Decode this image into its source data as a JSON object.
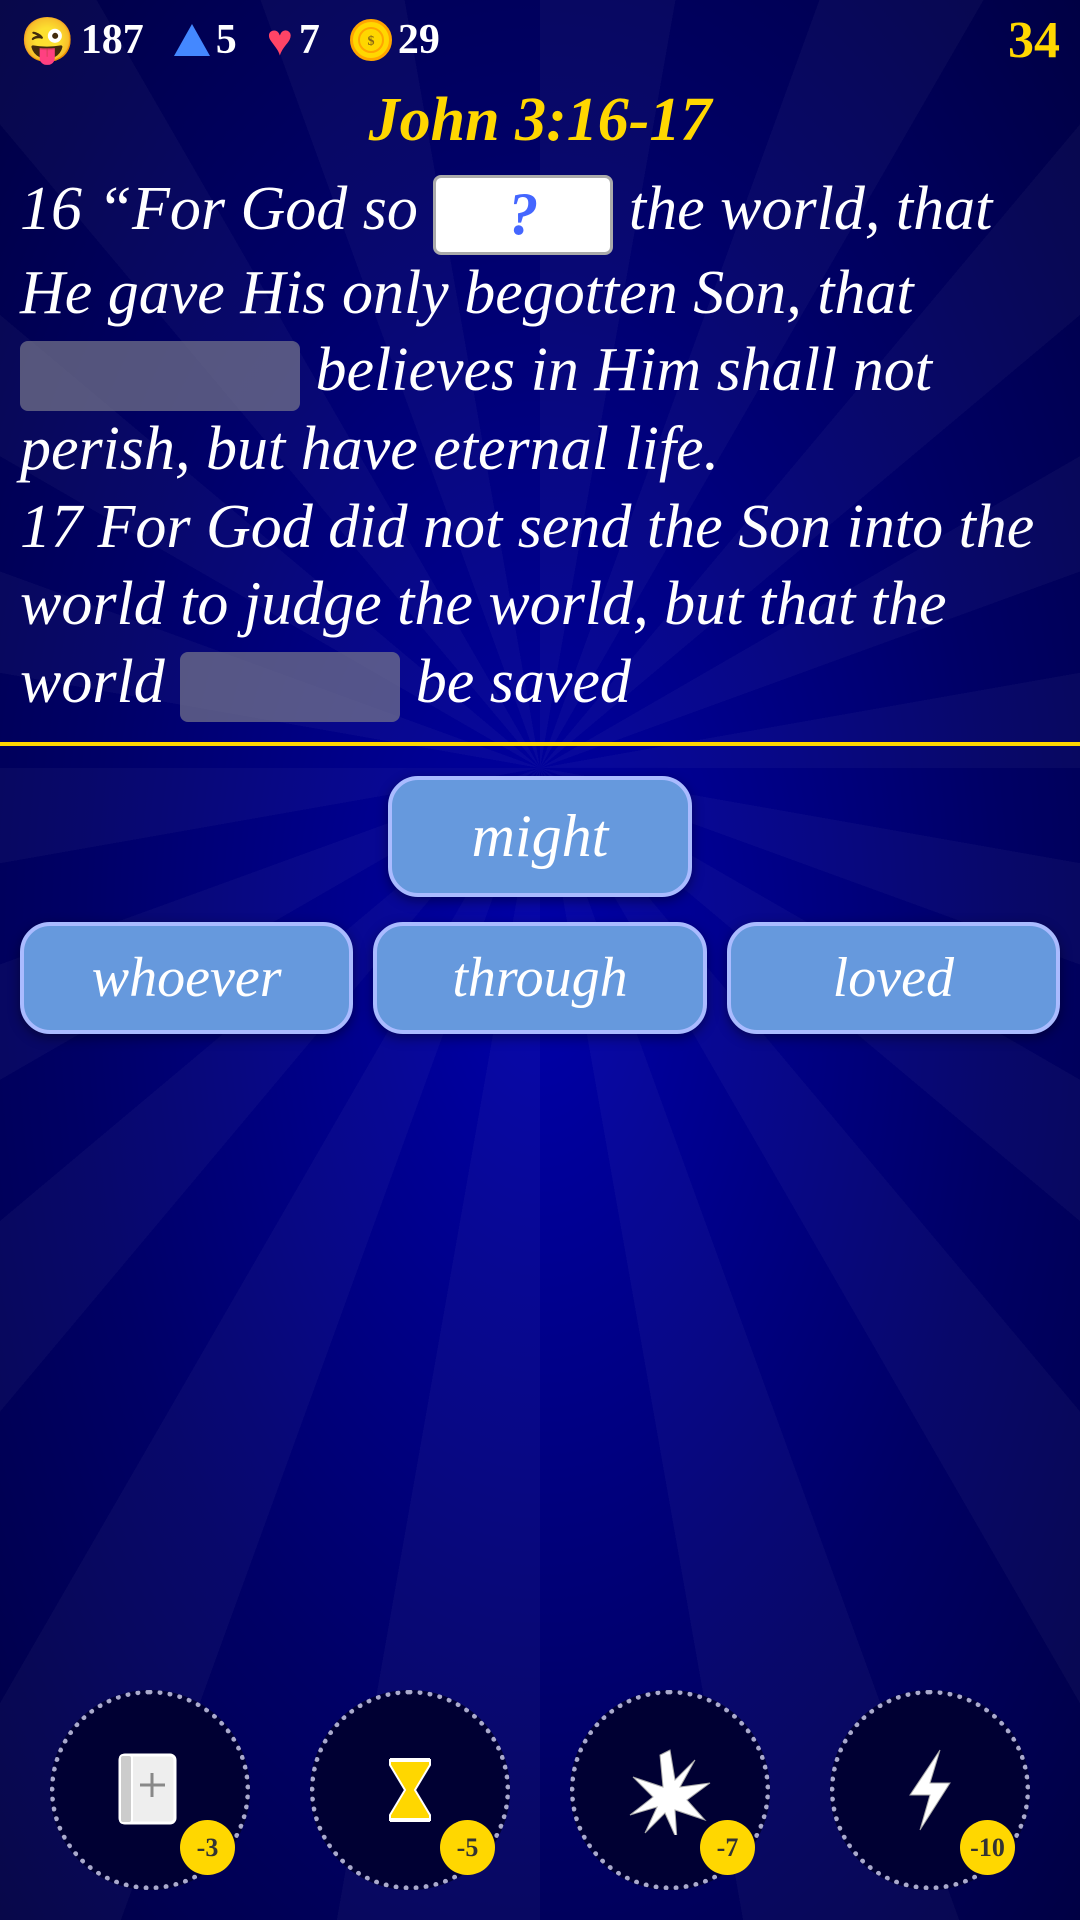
{
  "statusBar": {
    "emoji": "😜",
    "emojiScore": "187",
    "arrowScore": "5",
    "heartScore": "7",
    "coinScore": "29",
    "levelScore": "34"
  },
  "verseTitle": "John 3:16-17",
  "verseText": {
    "line1": "16 “For God so",
    "blank1Label": "?",
    "line2": "the world, that He gave His only begotten Son, that",
    "blank2Label": "",
    "line3": "believes in Him shall not perish, but have eternal life.",
    "line4": "17 For God did not send the Son into the world to judge the world, but that the world",
    "blank3Label": "",
    "line5": "be saved"
  },
  "answers": {
    "topBtn": "might",
    "bottomBtns": [
      "whoever",
      "through",
      "loved"
    ]
  },
  "powerups": [
    {
      "name": "bible",
      "cost": "-3",
      "symbol": "📖"
    },
    {
      "name": "hourglass",
      "cost": "-5",
      "symbol": "⏳"
    },
    {
      "name": "burst",
      "cost": "-7",
      "symbol": "💥"
    },
    {
      "name": "lightning",
      "cost": "-10",
      "symbol": "⚡"
    }
  ]
}
